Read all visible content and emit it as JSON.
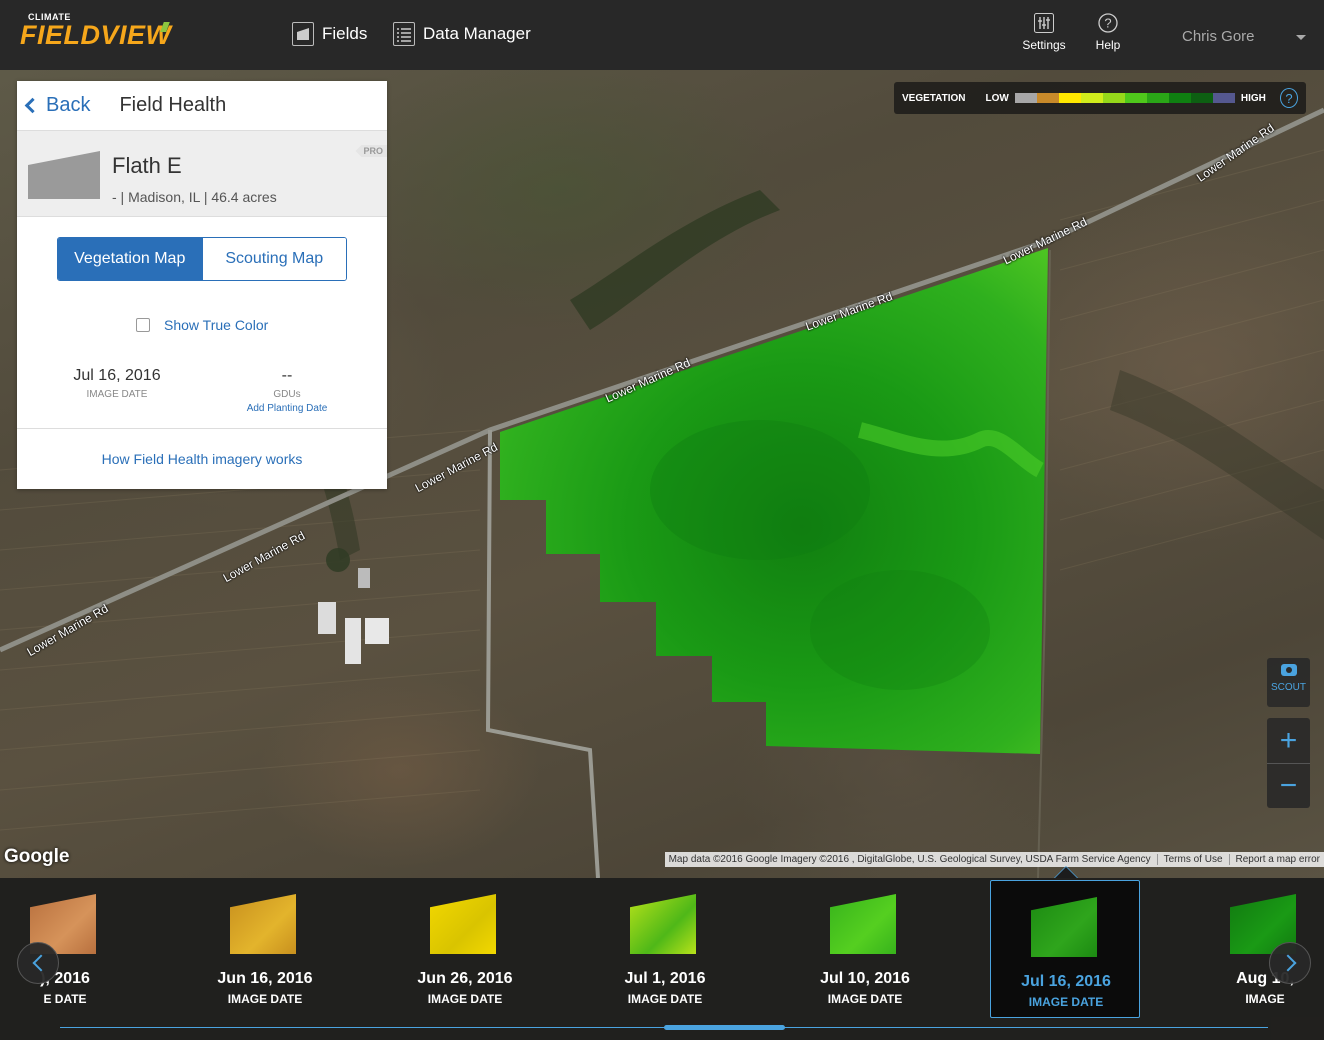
{
  "app": {
    "logo_small": "CLIMATE",
    "logo_main": "FIELDVIEW"
  },
  "nav": {
    "fields_label": "Fields",
    "data_manager_label": "Data Manager"
  },
  "tools": {
    "settings_label": "Settings",
    "help_label": "Help",
    "user_name": "Chris Gore"
  },
  "legend": {
    "title": "VEGETATION",
    "low": "LOW",
    "high": "HIGH",
    "colors": [
      "#a7a7a7",
      "#c88a2a",
      "#ffe800",
      "#d1ec1c",
      "#96d81a",
      "#4fc81b",
      "#2aa617",
      "#0f7f11",
      "#0d5f12",
      "#55588f"
    ]
  },
  "panel": {
    "back_label": "Back",
    "title": "Field Health",
    "field_name": "Flath E",
    "field_meta": "-  |  Madison, IL  |  46.4 acres",
    "pro_badge": "PRO",
    "tab_vegetation": "Vegetation Map",
    "tab_scouting": "Scouting Map",
    "show_true_color": "Show True Color",
    "image_date_value": "Jul 16, 2016",
    "image_date_label": "IMAGE DATE",
    "gdu_value": "--",
    "gdu_label": "GDUs",
    "add_planting": "Add Planting Date",
    "how_link": "How Field Health imagery works"
  },
  "map": {
    "road_name": "Lower Marine Rd",
    "google_logo": "Google",
    "attribution": "Map data ©2016 Google Imagery ©2016 , DigitalGlobe, U.S. Geological Survey, USDA Farm Service Agency",
    "terms": "Terms of Use",
    "report": "Report a map error"
  },
  "controls": {
    "scout_label": "SCOUT",
    "zoom_in": "+",
    "zoom_out": "−"
  },
  "timeline": [
    {
      "date": "), 2016",
      "label": "E DATE",
      "color_a": "#b8703e",
      "color_b": "#d6935a"
    },
    {
      "date": "Jun 16, 2016",
      "label": "IMAGE DATE",
      "color_a": "#c8901e",
      "color_b": "#e3b42c"
    },
    {
      "date": "Jun 26, 2016",
      "label": "IMAGE DATE",
      "color_a": "#f2d800",
      "color_b": "#d9c400"
    },
    {
      "date": "Jul 1, 2016",
      "label": "IMAGE DATE",
      "color_a": "#b8e21a",
      "color_b": "#4fb818"
    },
    {
      "date": "Jul 10, 2016",
      "label": "IMAGE DATE",
      "color_a": "#37b31c",
      "color_b": "#55cf20"
    },
    {
      "date": "Jul 16, 2016",
      "label": "IMAGE DATE",
      "color_a": "#1c8a12",
      "color_b": "#2fa51c"
    },
    {
      "date": "Aug 10,",
      "label": "IMAGE",
      "color_a": "#117a10",
      "color_b": "#1a9a15"
    }
  ]
}
